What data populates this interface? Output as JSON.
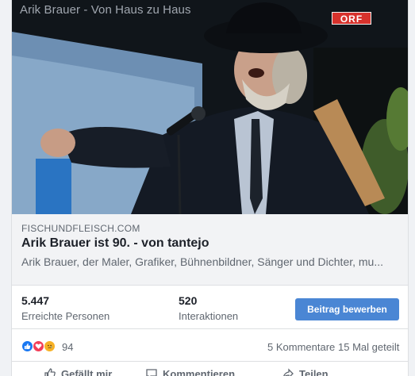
{
  "video": {
    "frame_title": "Arik Brauer - Von Haus zu Haus",
    "channel_logo": "ORF"
  },
  "link_preview": {
    "domain": "FISCHUNDFLEISCH.COM",
    "title": "Arik Brauer ist 90. - von tantejo",
    "description": "Arik Brauer, der Maler, Grafiker, Bühnenbildner, Sänger und Dichter, mu..."
  },
  "stats": {
    "reach_value": "5.447",
    "reach_label": "Erreichte Personen",
    "interactions_value": "520",
    "interactions_label": "Interaktionen",
    "boost_label": "Beitrag bewerben"
  },
  "reactions": {
    "icons": [
      "like-icon",
      "love-icon",
      "sad-icon"
    ],
    "count": "94",
    "comments": "5 Kommentare",
    "shares": "15 Mal geteilt"
  },
  "actions": {
    "like": "Gefällt mir",
    "comment": "Kommentieren",
    "share": "Teilen"
  },
  "colors": {
    "accent": "#4a86d4",
    "like": "#1877f2",
    "love": "#f33e58",
    "sad": "#f7b125"
  }
}
